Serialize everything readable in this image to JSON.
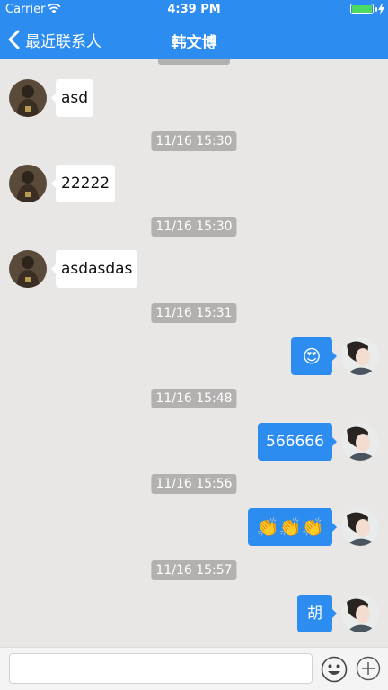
{
  "status_bar": {
    "carrier": "Carrier",
    "time": "4:39 PM"
  },
  "nav": {
    "back_label": "最近联系人",
    "title": "韩文博"
  },
  "messages": [
    {
      "timestamp": "",
      "direction": "in",
      "text": "asd"
    },
    {
      "timestamp": "11/16 15:30",
      "direction": "in",
      "text": "22222"
    },
    {
      "timestamp": "11/16 15:30",
      "direction": "in",
      "text": "asdasdas"
    },
    {
      "timestamp": "11/16 15:31",
      "direction": "out",
      "text": "😍"
    },
    {
      "timestamp": "11/16 15:48",
      "direction": "out",
      "text": "566666"
    },
    {
      "timestamp": "11/16 15:56",
      "direction": "out",
      "text": "👏👏👏"
    },
    {
      "timestamp": "11/16 15:57",
      "direction": "out",
      "text": "胡"
    }
  ],
  "input_bar": {
    "value": "",
    "placeholder": ""
  },
  "icons": {
    "back": "chevron-left-icon",
    "emoji": "smiley-face-icon",
    "attach": "plus-circle-icon",
    "wifi": "wifi-icon",
    "battery": "battery-icon"
  },
  "colors": {
    "accent": "#2d8cf0",
    "background": "#e9e7e6",
    "timestamp_bg": "#b3b1b0",
    "battery_fill": "#4cd964"
  }
}
